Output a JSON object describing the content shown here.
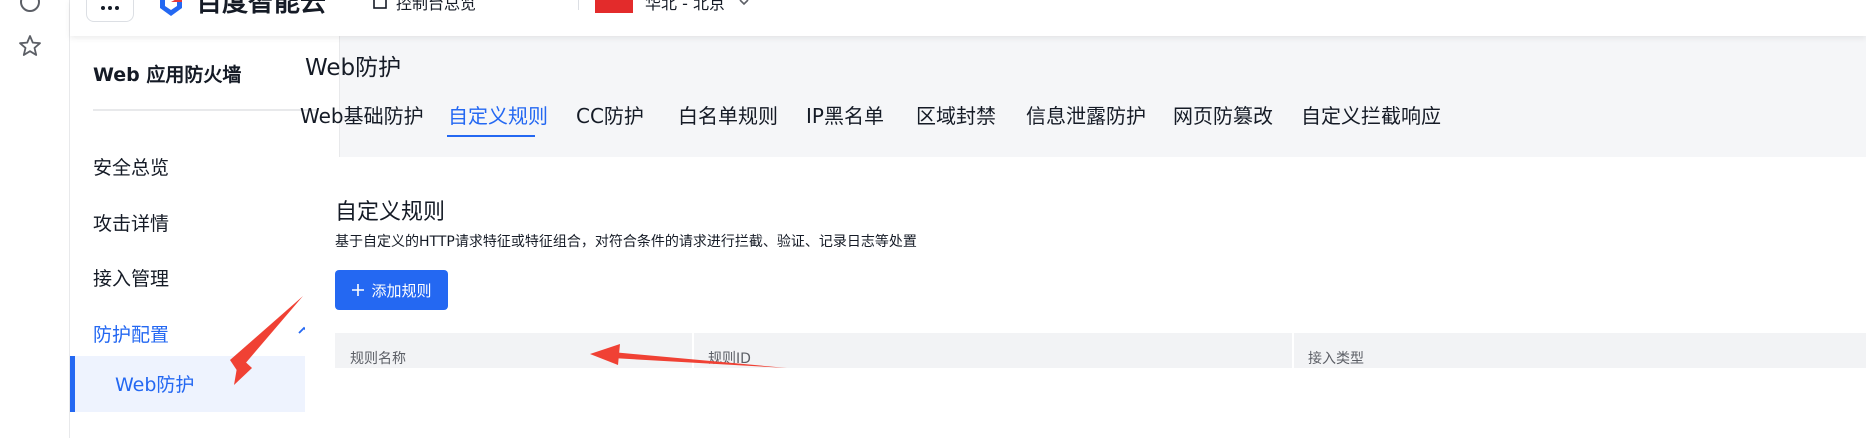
{
  "header": {
    "logo_text": "百度智能云",
    "console_label": "控制台总览",
    "region_label": "华北 - 北京"
  },
  "sidebar": {
    "title": "Web 应用防火墙",
    "items": [
      {
        "label": "安全总览"
      },
      {
        "label": "攻击详情"
      },
      {
        "label": "接入管理"
      },
      {
        "label": "防护配置"
      }
    ],
    "sub_item": {
      "label": "Web防护"
    }
  },
  "main": {
    "page_title": "Web防护",
    "tabs": [
      {
        "label": "Web基础防护"
      },
      {
        "label": "自定义规则"
      },
      {
        "label": "CC防护"
      },
      {
        "label": "白名单规则"
      },
      {
        "label": "IP黑名单"
      },
      {
        "label": "区域封禁"
      },
      {
        "label": "信息泄露防护"
      },
      {
        "label": "网页防篡改"
      },
      {
        "label": "自定义拦截响应"
      }
    ],
    "active_tab": "自定义规则",
    "card": {
      "title": "自定义规则",
      "description": "基于自定义的HTTP请求特征或特征组合，对符合条件的请求进行拦截、验证、记录日志等处置",
      "add_button_label": "添加规则",
      "table_headers": [
        "规则名称",
        "规则ID",
        "接入类型"
      ]
    }
  },
  "colors": {
    "accent": "#2468f2",
    "annotation_arrow": "#f04134",
    "table_header_bg": "#f2f3f5"
  },
  "icons": [
    "apps-grid-icon",
    "baidu-cloud-logo",
    "console-icon",
    "china-flag-icon",
    "chevron-down-icon",
    "chevron-up-icon",
    "plus-icon",
    "star-icon",
    "circle-icon"
  ]
}
